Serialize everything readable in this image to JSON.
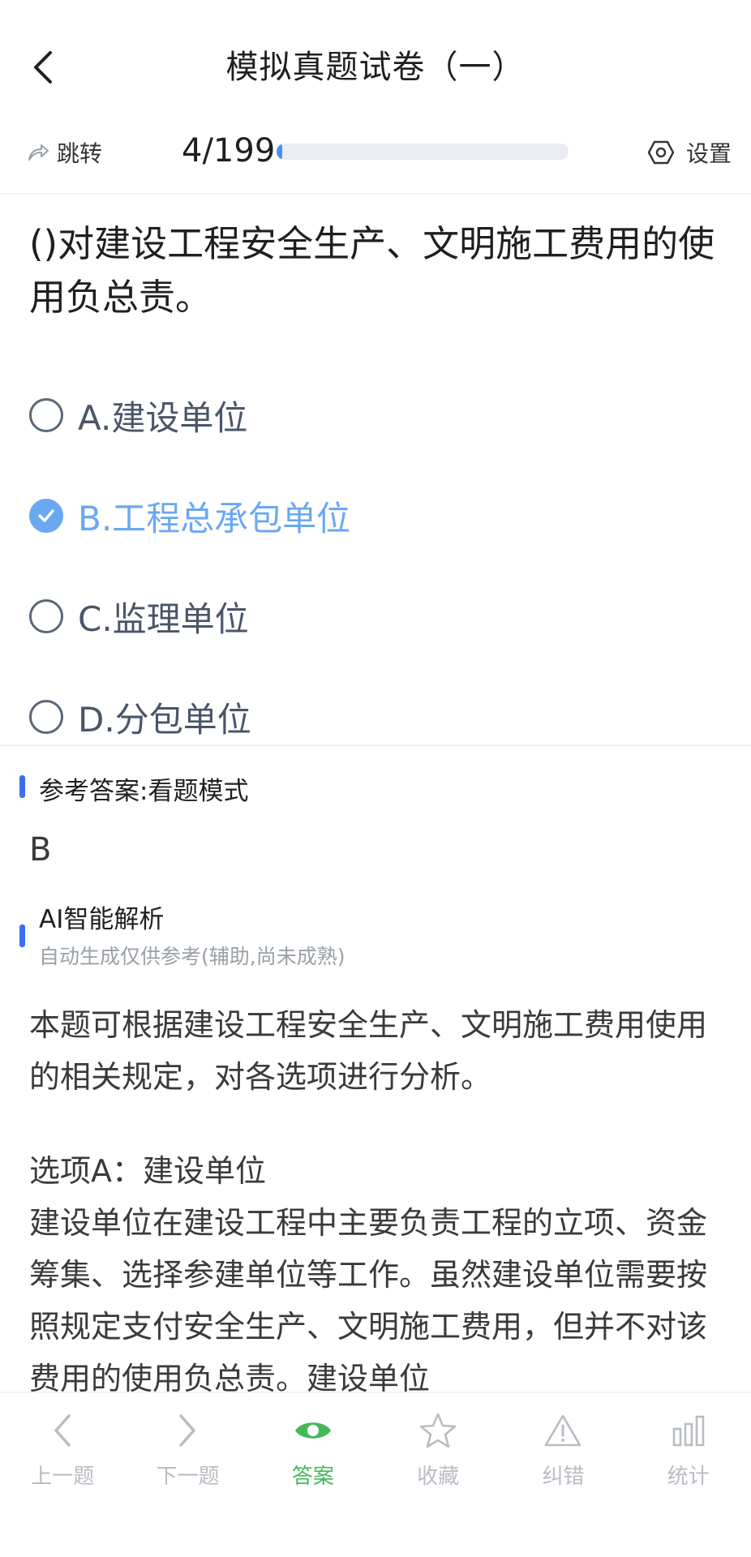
{
  "header": {
    "title": "模拟真题试卷（一）"
  },
  "toolbar": {
    "jump_label": "跳转",
    "current": "4/199",
    "progress": 0.0201,
    "settings_label": "设置"
  },
  "question": {
    "text": "()对建设工程安全生产、文明施工费用的使用负总责。",
    "options": [
      {
        "label": "A.建设单位",
        "selected": false
      },
      {
        "label": "B.工程总承包单位",
        "selected": true
      },
      {
        "label": "C.监理单位",
        "selected": false
      },
      {
        "label": "D.分包单位",
        "selected": false
      }
    ]
  },
  "reference": {
    "title": "参考答案:看题模式",
    "answer": "B"
  },
  "ai": {
    "title": "AI智能解析",
    "subtitle": "自动生成仅供参考(辅助,尚未成熟)",
    "para1": "本题可根据建设工程安全生产、文明施工费用使用的相关规定，对各选项进行分析。",
    "para2_title": "选项A：建设单位",
    "para2": "建设单位在建设工程中主要负责工程的立项、资金筹集、选择参建单位等工作。虽然建设单位需要按照规定支付安全生产、文明施工费用，但并不对该费用的使用负总责。建设单位"
  },
  "colors": {
    "accent_blue": "#6aa8f2",
    "section_bar": "#3b6ff0",
    "nav_active": "#46b85c",
    "nav_inactive": "#b9bdc3"
  },
  "bottom_nav": [
    {
      "label": "上一题",
      "icon": "chevron-left-icon",
      "active": false
    },
    {
      "label": "下一题",
      "icon": "chevron-right-icon",
      "active": false
    },
    {
      "label": "答案",
      "icon": "eye-icon",
      "active": true
    },
    {
      "label": "收藏",
      "icon": "star-icon",
      "active": false
    },
    {
      "label": "纠错",
      "icon": "warning-icon",
      "active": false
    },
    {
      "label": "统计",
      "icon": "bar-chart-icon",
      "active": false
    }
  ]
}
